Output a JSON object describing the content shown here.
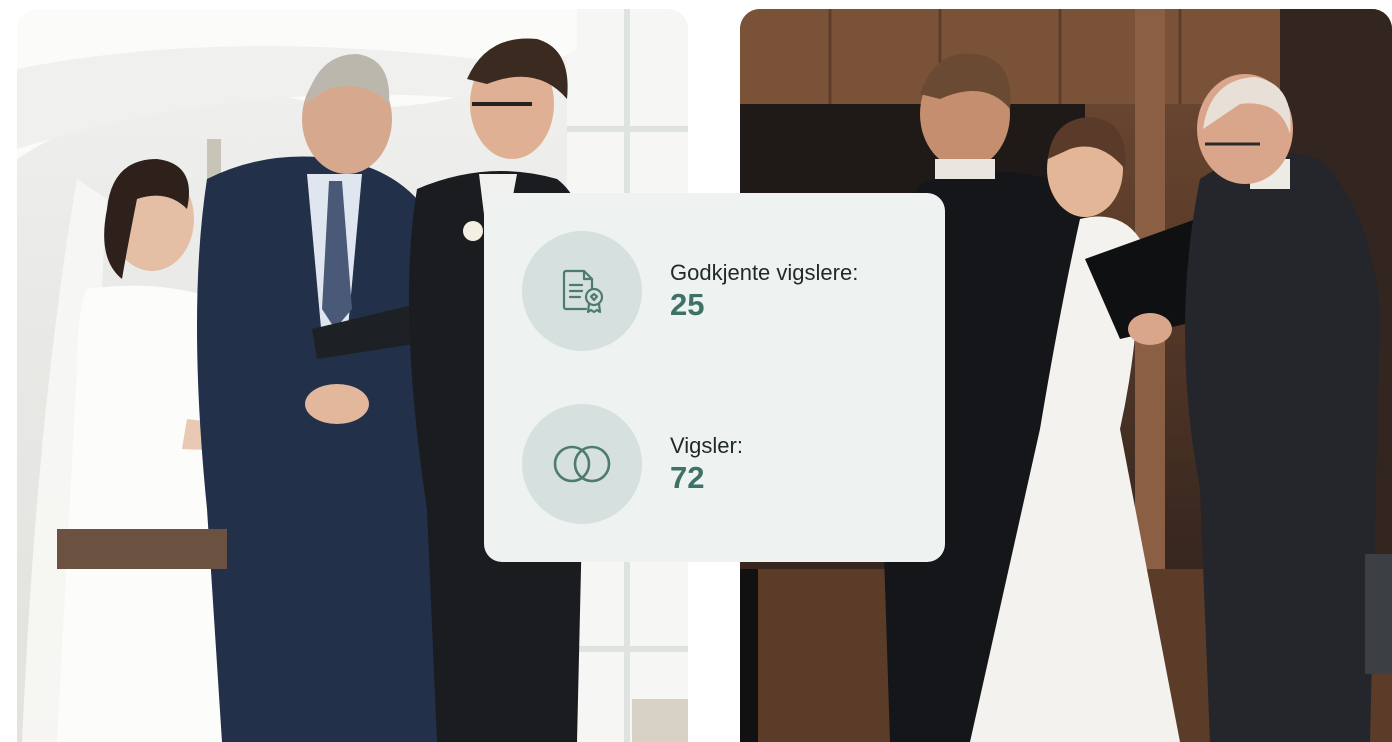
{
  "stats": [
    {
      "icon": "certificate-icon",
      "label": "Godkjente vigslere:",
      "value": "25"
    },
    {
      "icon": "rings-icon",
      "label": "Vigsler:",
      "value": "72"
    }
  ],
  "colors": {
    "card_background": "#eef3f2",
    "icon_circle": "#d6e0de",
    "icon_stroke": "#4f7a72",
    "value_text": "#3f7168",
    "label_text": "#1f2a29"
  }
}
